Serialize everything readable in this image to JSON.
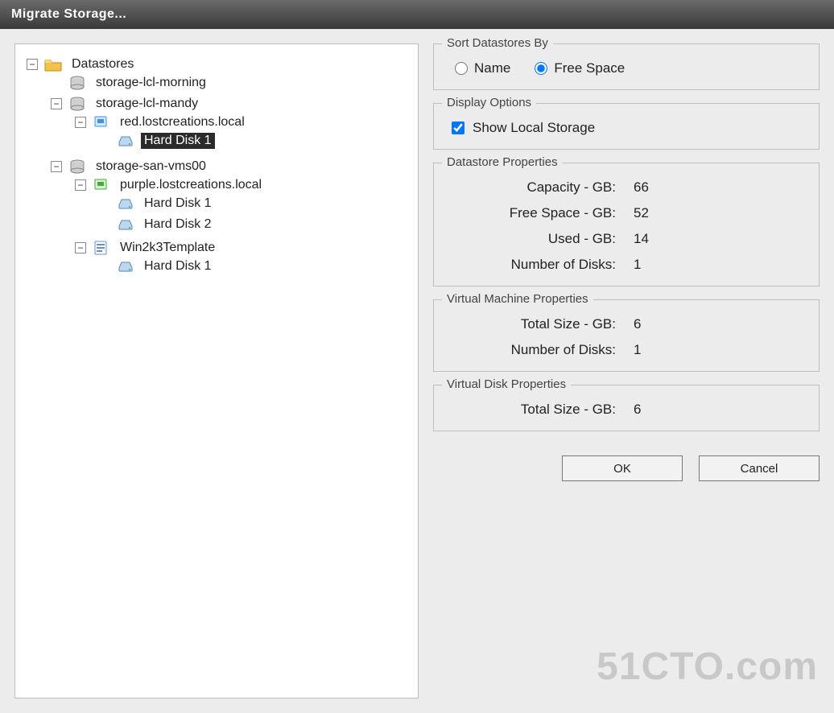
{
  "window": {
    "title": "Migrate Storage..."
  },
  "tree": {
    "root_label": "Datastores",
    "nodes": [
      {
        "label": "storage-lcl-morning"
      },
      {
        "label": "storage-lcl-mandy",
        "children": [
          {
            "label": "red.lostcreations.local",
            "vm_color": "blue",
            "children": [
              {
                "label": "Hard Disk 1",
                "selected": true
              }
            ]
          }
        ]
      },
      {
        "label": "storage-san-vms00",
        "children": [
          {
            "label": "purple.lostcreations.local",
            "vm_color": "green",
            "children": [
              {
                "label": "Hard Disk 1"
              },
              {
                "label": "Hard Disk 2"
              }
            ]
          },
          {
            "label": "Win2k3Template",
            "vm_color": "template",
            "children": [
              {
                "label": "Hard Disk 1"
              }
            ]
          }
        ]
      }
    ]
  },
  "sort": {
    "group_label": "Sort Datastores By",
    "options": {
      "name": "Name",
      "free_space": "Free Space"
    },
    "selected": "free_space"
  },
  "display": {
    "group_label": "Display Options",
    "show_local_label": "Show Local Storage",
    "show_local_checked": true
  },
  "datastore_props": {
    "group_label": "Datastore Properties",
    "rows": {
      "capacity": {
        "label": "Capacity - GB:",
        "value": "66"
      },
      "free_space": {
        "label": "Free Space - GB:",
        "value": "52"
      },
      "used": {
        "label": "Used - GB:",
        "value": "14"
      },
      "num_disks": {
        "label": "Number of Disks:",
        "value": "1"
      }
    }
  },
  "vm_props": {
    "group_label": "Virtual Machine Properties",
    "rows": {
      "total_size": {
        "label": "Total Size - GB:",
        "value": "6"
      },
      "num_disks": {
        "label": "Number of Disks:",
        "value": "1"
      }
    }
  },
  "vdisk_props": {
    "group_label": "Virtual Disk Properties",
    "rows": {
      "total_size": {
        "label": "Total Size - GB:",
        "value": "6"
      }
    }
  },
  "buttons": {
    "ok": "OK",
    "cancel": "Cancel"
  },
  "watermark": "51CTO.com"
}
